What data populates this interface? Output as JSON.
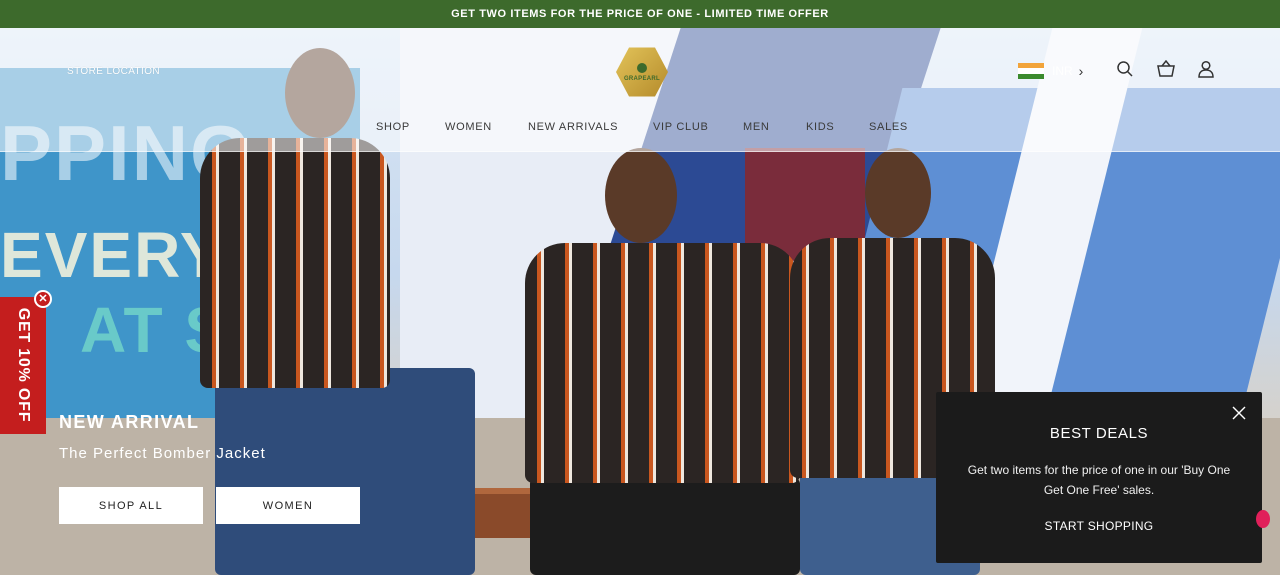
{
  "announcement": {
    "text": "GET TWO ITEMS FOR THE PRICE OF ONE - LIMITED TIME OFFER"
  },
  "header": {
    "store_location": "STORE LOCATION",
    "logo_text": "GRAPEARL",
    "currency": "INR",
    "flag_colors": [
      "#f2a43a",
      "#ffffff",
      "#3b8a2d"
    ],
    "icons": [
      "search-icon",
      "cart-icon",
      "account-icon"
    ]
  },
  "nav": {
    "items": [
      "SHOP",
      "WOMEN",
      "NEW ARRIVALS",
      "VIP CLUB",
      "MEN",
      "KIDS",
      "SALES"
    ]
  },
  "promo": {
    "tab_text": "GET 10% OFF",
    "close_glyph": "✕"
  },
  "hero": {
    "title": "NEW ARRIVAL",
    "subtitle": "The Perfect Bomber Jacket",
    "buttons": [
      "SHOP ALL",
      "WOMEN"
    ],
    "background_text": [
      "PPING",
      "EVERYO",
      "AT SU"
    ]
  },
  "popup": {
    "title": "BEST DEALS",
    "text": "Get two items for the price of one in our 'Buy One Get One Free' sales.",
    "cta": "START SHOPPING"
  },
  "colors": {
    "announcement_bg": "#3d6a2c",
    "promo_bg": "#c41e1e",
    "popup_bg": "#1b1b1b"
  }
}
